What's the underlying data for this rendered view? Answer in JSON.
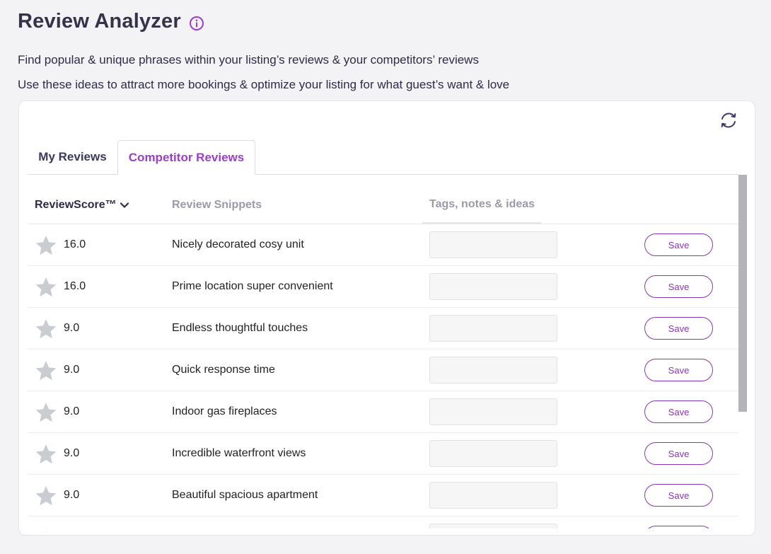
{
  "page": {
    "title": "Review Analyzer",
    "description_line1": "Find popular & unique phrases within your listing’s reviews & your competitors’ reviews",
    "description_line2": "Use these ideas to attract more bookings & optimize your listing for what guest’s want & love"
  },
  "tabs": [
    {
      "label": "My Reviews",
      "active": false
    },
    {
      "label": "Competitor Reviews",
      "active": true
    }
  ],
  "table": {
    "columns": {
      "score": "ReviewScore™",
      "snippets": "Review Snippets",
      "tags": "Tags, notes & ideas"
    },
    "save_label": "Save",
    "rows": [
      {
        "score": "16.0",
        "snippet": "Nicely decorated cosy unit",
        "note": ""
      },
      {
        "score": "16.0",
        "snippet": "Prime location super convenient",
        "note": ""
      },
      {
        "score": "9.0",
        "snippet": "Endless thoughtful touches",
        "note": ""
      },
      {
        "score": "9.0",
        "snippet": "Quick response time",
        "note": ""
      },
      {
        "score": "9.0",
        "snippet": "Indoor gas fireplaces",
        "note": ""
      },
      {
        "score": "9.0",
        "snippet": "Incredible waterfront views",
        "note": ""
      },
      {
        "score": "9.0",
        "snippet": "Beautiful spacious apartment",
        "note": ""
      },
      {
        "score": "",
        "snippet": "",
        "note": ""
      }
    ]
  },
  "icons": {
    "info": "info-icon",
    "refresh": "refresh-icon",
    "sort": "chevron-down-icon",
    "star": "star-icon"
  },
  "colors": {
    "accent": "#9a3fcc",
    "save_border": "#8b35b8",
    "star": "#c9ccd1",
    "background": "#f3f3f6"
  }
}
